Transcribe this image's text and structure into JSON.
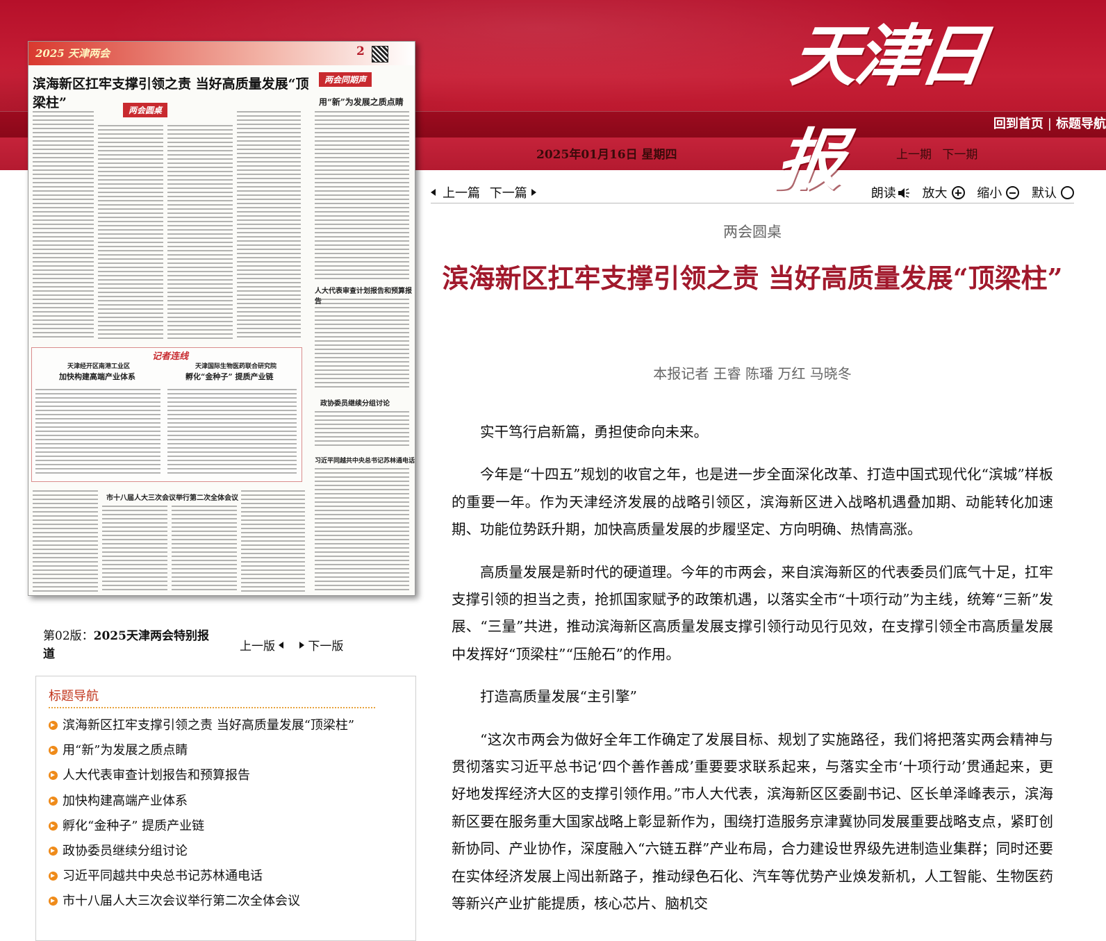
{
  "header": {
    "logo": "天津日报",
    "nav": [
      "回到首页",
      "标题导航"
    ],
    "date": "2025年01月16日 星期四",
    "prev_issue": "上一期",
    "next_issue": "下一期"
  },
  "paper_preview": {
    "banner": "2025 天津两会",
    "page_no": "2",
    "headline": "滨海新区扛牢支撑引领之责 当好高质量发展“顶梁柱”",
    "tag_roundtable": "两会圆桌",
    "tag_observe": "两会同期声",
    "tag_reporter": "记者连线",
    "sub_1": "用“新”为发展之质点睛",
    "sub_2": "人大代表审查计划报告和预算报告",
    "sub_3": "政协委员继续分组讨论",
    "sub_4": "习近平同越共中央总书记苏林通电话",
    "sub_5": "市十八届人大三次会议举行第二次全体会议",
    "box_a_org": "天津经开区南港工业区",
    "box_a_title": "加快构建高端产业体系",
    "box_b_org": "天津国际生物医药联合研究院",
    "box_b_title": "孵化“金种子” 提质产业链"
  },
  "edition": {
    "prefix": "第02版：",
    "name": "2025天津两会特别报道",
    "prev": "上一版",
    "next": "下一版"
  },
  "toc": {
    "title": "标题导航",
    "items": [
      "滨海新区扛牢支撑引领之责 当好高质量发展“顶梁柱”",
      "用“新”为发展之质点睛",
      "人大代表审查计划报告和预算报告",
      "加快构建高端产业体系",
      "孵化“金种子” 提质产业链",
      "政协委员继续分组讨论",
      "习近平同越共中央总书记苏林通电话",
      "市十八届人大三次会议举行第二次全体会议"
    ]
  },
  "article_tools": {
    "prev": "上一篇",
    "next": "下一篇",
    "read": "朗读",
    "zoom_in": "放大",
    "zoom_out": "缩小",
    "default": "默认"
  },
  "article": {
    "section": "两会圆桌",
    "title": "滨海新区扛牢支撑引领之责 当好高质量发展“顶梁柱”",
    "byline": "本报记者 王睿 陈璠 万红 马晓冬",
    "paragraphs": [
      "实干笃行启新篇，勇担使命向未来。",
      "今年是“十四五”规划的收官之年，也是进一步全面深化改革、打造中国式现代化“滨城”样板的重要一年。作为天津经济发展的战略引领区，滨海新区进入战略机遇叠加期、动能转化加速期、功能位势跃升期，加快高质量发展的步履坚定、方向明确、热情高涨。",
      "高质量发展是新时代的硬道理。今年的市两会，来自滨海新区的代表委员们底气十足，扛牢支撑引领的担当之责，抢抓国家赋予的政策机遇，以落实全市“十项行动”为主线，统筹“三新”发展、“三量”共进，推动滨海新区高质量发展支撑引领行动见行见效，在支撑引领全市高质量发展中发挥好“顶梁柱”“压舱石”的作用。",
      "打造高质量发展“主引擎”",
      "“这次市两会为做好全年工作确定了发展目标、规划了实施路径，我们将把落实两会精神与贯彻落实习近平总书记‘四个善作善成’重要要求联系起来，与落实全市‘十项行动’贯通起来，更好地发挥经济大区的支撑引领作用。”市人大代表，滨海新区区委副书记、区长单泽峰表示，滨海新区要在服务重大国家战略上彰显新作为，围绕打造服务京津冀协同发展重要战略支点，紧盯创新协同、产业协作，深度融入“六链五群”产业布局，合力建设世界级先进制造业集群；同时还要在实体经济发展上闯出新路子，推动绿色石化、汽车等优势产业焕发新机，人工智能、生物医药等新兴产业扩能提质，核心芯片、脑机交"
    ]
  },
  "colors": {
    "header_red": "#c71f36",
    "title_red": "#a1192c",
    "toc_title": "#c2361c",
    "bullet_orange": "#ef8b1a"
  }
}
